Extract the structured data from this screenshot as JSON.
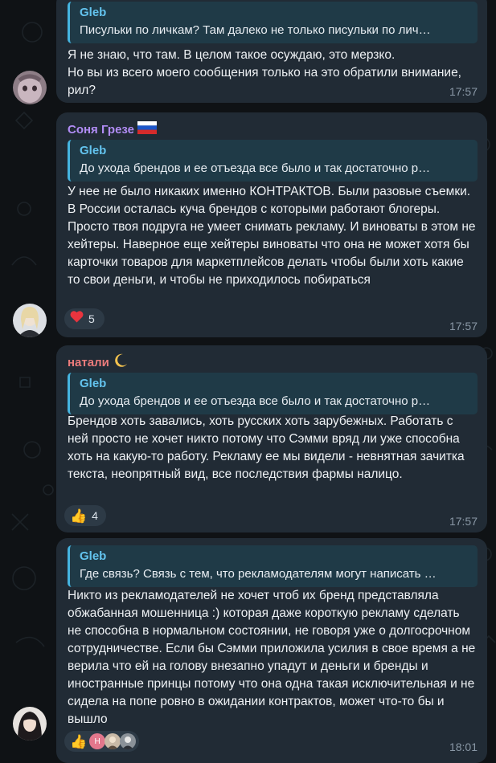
{
  "messages": [
    {
      "sender": "",
      "reply": {
        "name": "Gleb",
        "text": "Писульки по личкам? Там далеко не только писульки по лич…"
      },
      "text": "Я не знаю, что там. В целом такое осуждаю, это мерзко.\nНо вы из всего моего сообщения только на это обратили внимание, рил?",
      "time": "17:57",
      "reaction": null
    },
    {
      "sender": "Соня Грезе",
      "sender_color": "#b18cf5",
      "sender_icon": "russia-flag-icon",
      "reply": {
        "name": "Gleb",
        "text": "До ухода брендов и ее отъезда все было и так достаточно р…"
      },
      "text": "У нее не было никаких именно КОНТРАКТОВ. Были разовые съемки. В России осталась куча брендов с которыми работают блогеры. Просто твоя подруга не умеет снимать рекламу. И виноваты в этом не хейтеры. Наверное еще хейтеры виноваты что она не может хотя бы карточки товаров для маркетплейсов делать чтобы были хоть какие то свои деньги, и чтобы не приходилось побираться",
      "time": "17:57",
      "reaction": {
        "icon": "heart-icon",
        "count": "5"
      }
    },
    {
      "sender": "натали",
      "sender_color": "#ea7b7b",
      "sender_icon": "crescent-moon-icon",
      "reply": {
        "name": "Gleb",
        "text": "До ухода брендов и ее отъезда все было и так достаточно р…"
      },
      "text": "Брендов хоть завались, хоть русских хоть зарубежных. Работать с ней просто не хочет никто потому что Сэмми вряд ли уже способна хоть на какую-то работу. Рекламу ее мы видели - невнятная зачитка текста, неопрятный вид, все последствия фармы налицо.",
      "time": "17:57",
      "reaction": {
        "icon": "thumbs-up-icon",
        "count": "4"
      }
    },
    {
      "sender": "",
      "reply": {
        "name": "Gleb",
        "text": "Где связь? Связь с тем, что рекламодателям могут написать …"
      },
      "text": "Никто из рекламодателей не хочет чтоб их бренд представляла обжабанная мошенница :) которая даже короткую рекламу сделать не способна в нормальном состоянии, не говоря уже о долгосрочном сотрудничестве. Если бы Сэмми приложила усилия в свое время а не верила что ей на голову внезапно упадут и деньги и бренды и иностранные принцы потому что она одна такая исключительная и не сидела на попе ровно в ожидании контрактов, может что-то бы и вышло",
      "time": "18:01",
      "reaction": {
        "icon": "thumbs-up-icon",
        "count": "",
        "reactor_initial": "Н"
      }
    }
  ]
}
